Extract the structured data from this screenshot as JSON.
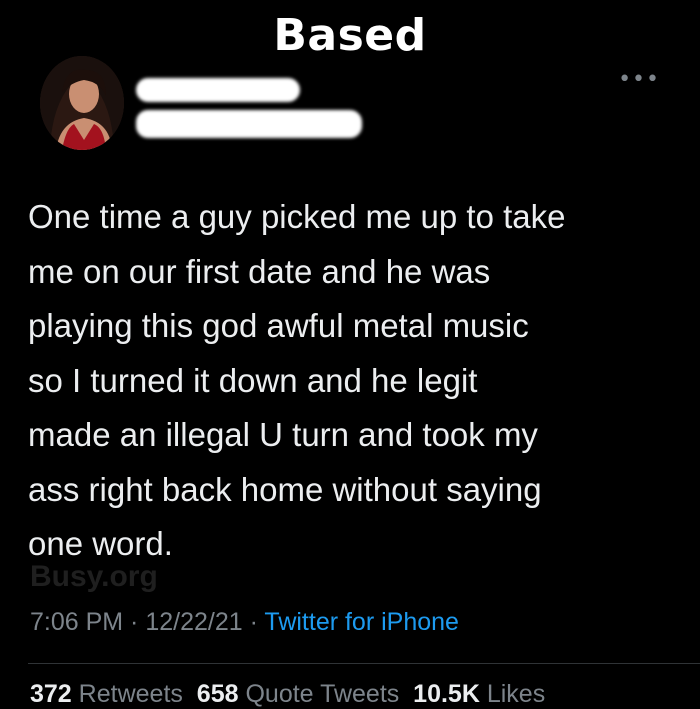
{
  "meme": {
    "title": "Based"
  },
  "tweet": {
    "more_icon": "more-horizontal-icon",
    "lines": [
      "One time a guy picked me up to take",
      "me on our first date and he was",
      "playing this god awful metal music",
      "so I turned it down and he legit",
      "made an illegal U turn and took my",
      "ass right back home without saying",
      "one word."
    ],
    "watermark": "Busy.org",
    "time": "7:06 PM",
    "date": "12/22/21",
    "source": "Twitter for iPhone",
    "separator": " · "
  },
  "stats": {
    "retweets_count": "372",
    "retweets_label": "Retweets",
    "quotes_count": "658",
    "quotes_label": "Quote Tweets",
    "likes_count": "10.5K",
    "likes_label": "Likes"
  },
  "colors": {
    "background": "#000000",
    "text": "#eceef0",
    "muted": "#7d848b",
    "link": "#1d9bf0"
  }
}
